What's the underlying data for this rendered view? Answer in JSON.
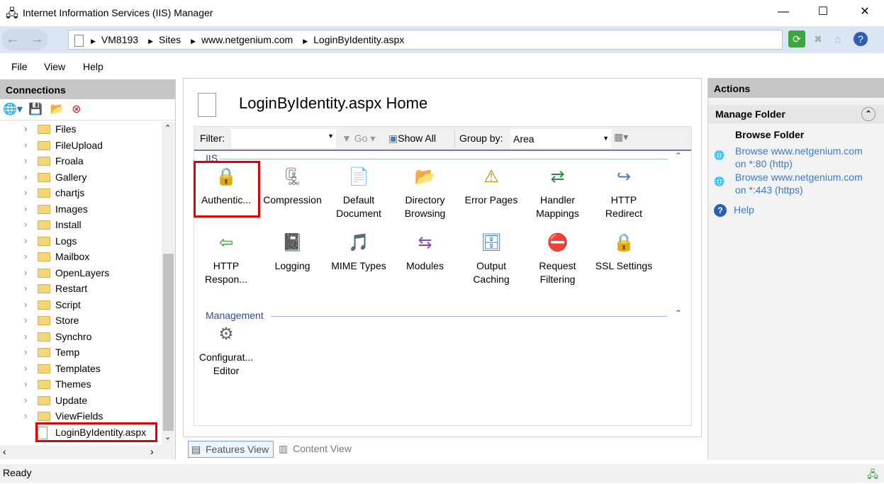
{
  "window": {
    "title": "Internet Information Services (IIS) Manager",
    "minimize": "—",
    "maximize": "☐",
    "close": "✕"
  },
  "address": {
    "crumbs": [
      "VM8193",
      "Sites",
      "www.netgenium.com",
      "LoginByIdentity.aspx"
    ]
  },
  "menu": [
    "File",
    "View",
    "Help"
  ],
  "connections": {
    "title": "Connections",
    "tree": [
      "Files",
      "FileUpload",
      "Froala",
      "Gallery",
      "chartjs",
      "Images",
      "Install",
      "Logs",
      "Mailbox",
      "OpenLayers",
      "Restart",
      "Script",
      "Store",
      "Synchro",
      "Temp",
      "Templates",
      "Themes",
      "Update",
      "ViewFields"
    ],
    "selected": "LoginByIdentity.aspx"
  },
  "center": {
    "title": "LoginByIdentity.aspx Home",
    "filter_label": "Filter:",
    "filter_value": "",
    "go": "Go",
    "show_all": "Show All",
    "group_by_label": "Group by:",
    "group_by_value": "Area",
    "groups": [
      {
        "name": "IIS",
        "features": [
          [
            "Authentic..."
          ],
          [
            "Compression"
          ],
          [
            "Default",
            "Document"
          ],
          [
            "Directory",
            "Browsing"
          ],
          [
            "Error Pages"
          ],
          [
            "Handler",
            "Mappings"
          ],
          [
            "HTTP",
            "Redirect"
          ],
          [
            "HTTP",
            "Respon..."
          ],
          [
            "Logging"
          ],
          [
            "MIME Types"
          ],
          [
            "Modules"
          ],
          [
            "Output",
            "Caching"
          ],
          [
            "Request",
            "Filtering"
          ],
          [
            "SSL Settings"
          ]
        ]
      },
      {
        "name": "Management",
        "features": [
          [
            "Configurat...",
            "Editor"
          ]
        ]
      }
    ],
    "tabs": [
      "Features View",
      "Content View"
    ]
  },
  "actions": {
    "title": "Actions",
    "section": "Manage Folder",
    "subhead": "Browse Folder",
    "links": [
      [
        "Browse www.netgenium.com",
        "on *:80 (http)"
      ],
      [
        "Browse www.netgenium.com",
        "on *:443 (https)"
      ]
    ],
    "help": "Help"
  },
  "status": "Ready",
  "colors": {
    "highlight": "#e00000",
    "link": "#3b79c9"
  }
}
